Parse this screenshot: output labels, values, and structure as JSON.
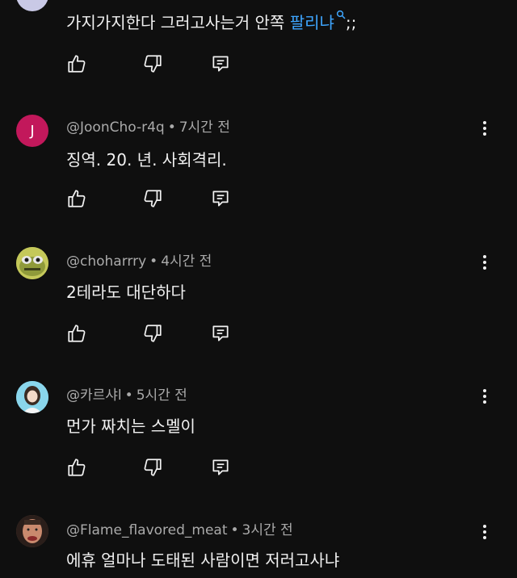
{
  "comments": [
    {
      "text": "가지가지한다 그러고사는거 안쪽",
      "link": "팔리냐",
      "text_suffix": ";;"
    },
    {
      "avatar_letter": "J",
      "avatar_color": "#c2185b",
      "handle": "@JoonCho-r4q",
      "time": "7시간 전",
      "text": "징역. 20. 년. 사회격리."
    },
    {
      "handle": "@choharrry",
      "time": "4시간 전",
      "text": "2테라도 대단하다"
    },
    {
      "handle": "@카르샤l",
      "time": "5시간 전",
      "text": "먼가 짜치는 스멜이"
    },
    {
      "handle": "@Flame_flavored_meat",
      "time": "3시간 전",
      "text": "에휴 얼마나 도태된 사람이면 저러고사냐"
    }
  ],
  "separator": "•",
  "icons": {
    "like": "thumbs-up-icon",
    "dislike": "thumbs-down-icon",
    "reply": "reply-icon",
    "more": "more-vert-icon",
    "search": "search-icon"
  }
}
